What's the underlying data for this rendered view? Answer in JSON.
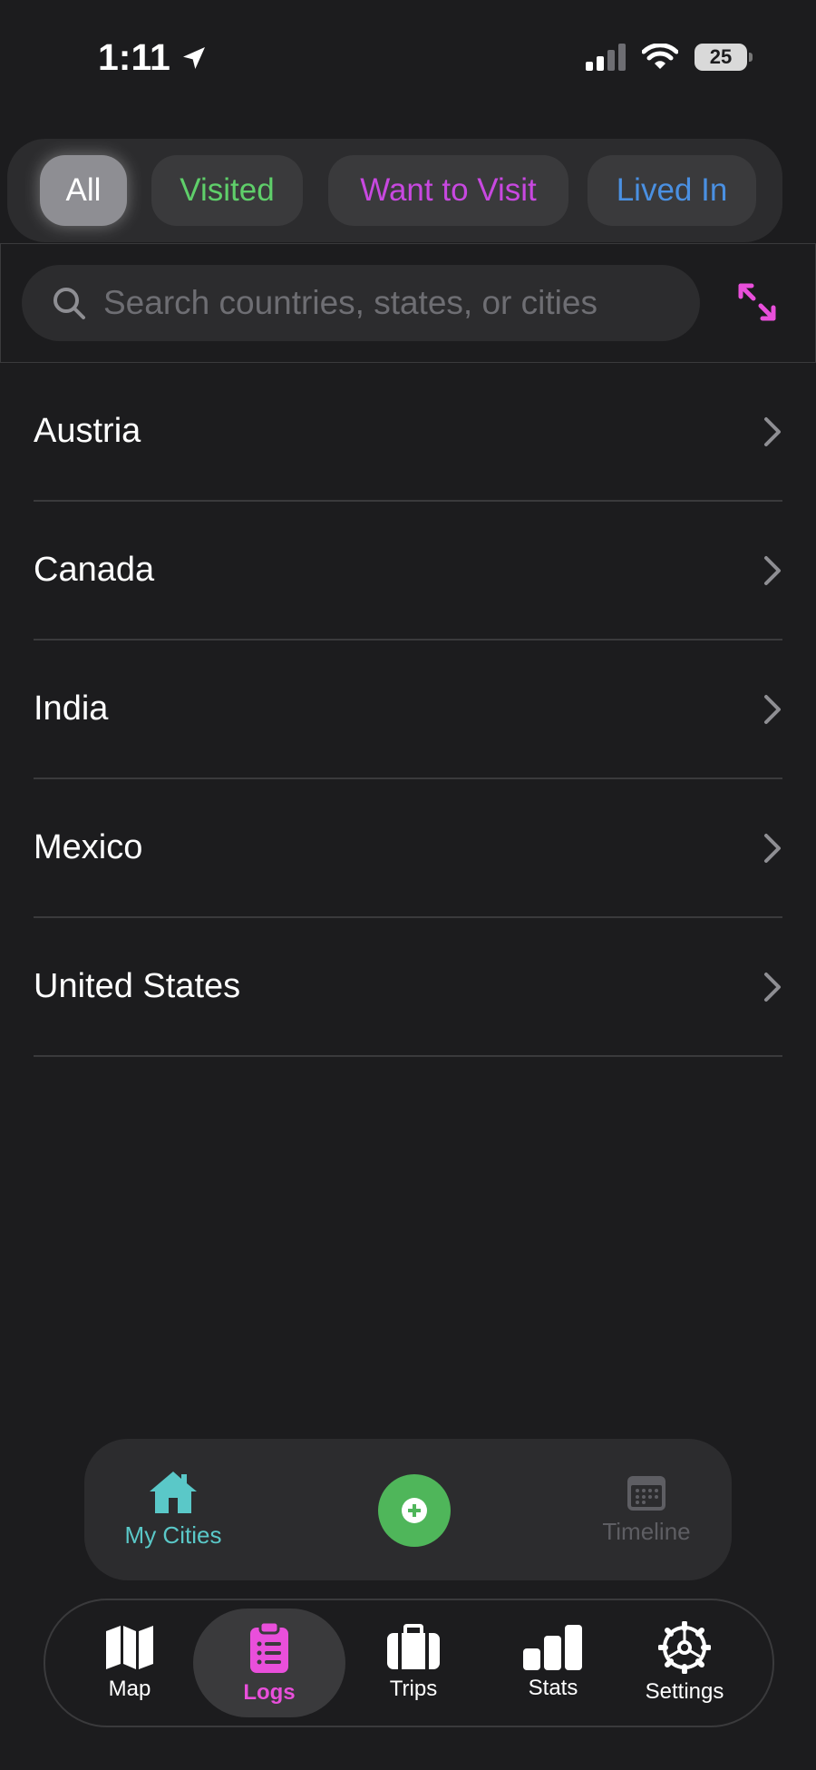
{
  "status_bar": {
    "time": "1:11",
    "battery": "25"
  },
  "filters": [
    {
      "label": "All",
      "color": "#ffffff",
      "active": true
    },
    {
      "label": "Visited",
      "color": "#5fcf6a"
    },
    {
      "label": "Want to Visit",
      "color": "#c848e0"
    },
    {
      "label": "Lived In",
      "color": "#4a90e2"
    }
  ],
  "search": {
    "placeholder": "Search countries, states, or cities"
  },
  "countries": [
    "Austria",
    "Canada",
    "India",
    "Mexico",
    "United States"
  ],
  "center_bar": {
    "my_cities_label": "My Cities",
    "my_cities_color": "#5ac8c8",
    "timeline_label": "Timeline",
    "timeline_color": "#5e5e63",
    "add_color": "#4fb65a"
  },
  "tabs": [
    {
      "label": "Map"
    },
    {
      "label": "Logs",
      "active": true,
      "color": "#e94fdb"
    },
    {
      "label": "Trips"
    },
    {
      "label": "Stats"
    },
    {
      "label": "Settings"
    }
  ]
}
